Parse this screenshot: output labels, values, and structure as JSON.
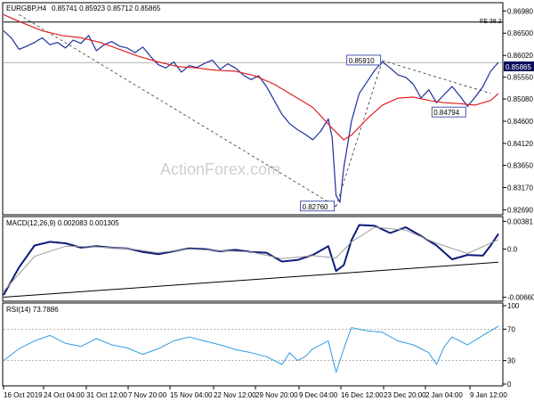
{
  "chart_data": {
    "type": "line",
    "instrument": {
      "symbol": "EURGBP,H4",
      "ohlc": "0.85741 0.85923 0.85712 0.85865"
    },
    "watermark": "ActionForex.com",
    "x_ticks": [
      "16 Oct 2019",
      "24 Oct 04:00",
      "31 Oct 12:00",
      "7 Nov 20:00",
      "15 Nov 04:00",
      "22 Nov 12:00",
      "29 Nov 20:00",
      "9 Dec 04:00",
      "16 Dec 12:00",
      "23 Dec 20:00",
      "2 Jan 04:00",
      "9 Jan 12:00"
    ],
    "price": {
      "y_ticks": [
        "0.86980",
        "0.86500",
        "0.86020",
        "0.85550",
        "0.85080",
        "0.84600",
        "0.84120",
        "0.83650",
        "0.83170",
        "0.82690"
      ],
      "ylim": [
        0.8264,
        0.8712
      ],
      "current_label": "0.85865",
      "fe_label": "FE 38.2",
      "fe_value": 0.8674,
      "annotations": [
        {
          "text": "0.85910",
          "x": 98,
          "y": 0.8591
        },
        {
          "text": "0.84794",
          "x": 120,
          "y": 0.8479
        },
        {
          "text": "0.82760",
          "x": 86,
          "y": 0.8276
        }
      ],
      "series": [
        {
          "name": "price",
          "color": "#1f2f9a",
          "x": [
            0,
            2,
            4,
            6,
            8,
            10,
            12,
            14,
            16,
            18,
            20,
            22,
            24,
            26,
            28,
            30,
            32,
            34,
            36,
            38,
            40,
            42,
            44,
            46,
            48,
            50,
            52,
            54,
            56,
            58,
            60,
            62,
            64,
            66,
            68,
            70,
            72,
            74,
            76,
            78,
            80,
            82,
            84,
            85,
            86,
            87,
            88,
            90,
            92,
            94,
            96,
            98,
            100,
            102,
            104,
            106,
            108,
            110,
            112,
            114,
            116,
            118,
            120,
            122,
            124,
            126,
            128
          ],
          "values": [
            0.8655,
            0.864,
            0.8615,
            0.8622,
            0.863,
            0.864,
            0.8625,
            0.863,
            0.8618,
            0.8635,
            0.8628,
            0.8645,
            0.8612,
            0.8625,
            0.8632,
            0.8622,
            0.8618,
            0.8608,
            0.862,
            0.86,
            0.8582,
            0.8575,
            0.8588,
            0.8566,
            0.858,
            0.8576,
            0.8585,
            0.8592,
            0.8572,
            0.8584,
            0.8575,
            0.856,
            0.855,
            0.8558,
            0.8535,
            0.8505,
            0.8475,
            0.8455,
            0.8442,
            0.8432,
            0.842,
            0.8438,
            0.8465,
            0.8425,
            0.83,
            0.8285,
            0.836,
            0.846,
            0.852,
            0.8545,
            0.857,
            0.8588,
            0.8575,
            0.856,
            0.8555,
            0.854,
            0.851,
            0.8528,
            0.85,
            0.8518,
            0.8535,
            0.8515,
            0.8492,
            0.8512,
            0.8535,
            0.8568,
            0.8587
          ]
        },
        {
          "name": "moving average",
          "color": "#e02020",
          "x": [
            0,
            5,
            10,
            15,
            20,
            25,
            30,
            35,
            40,
            45,
            50,
            55,
            60,
            65,
            70,
            75,
            80,
            85,
            88,
            90,
            94,
            98,
            102,
            106,
            110,
            114,
            118,
            122,
            126,
            128
          ],
          "values": [
            0.869,
            0.8672,
            0.8655,
            0.8645,
            0.864,
            0.863,
            0.8615,
            0.86,
            0.8588,
            0.8578,
            0.8575,
            0.857,
            0.8568,
            0.8558,
            0.854,
            0.8515,
            0.849,
            0.8445,
            0.842,
            0.843,
            0.8465,
            0.8495,
            0.851,
            0.8512,
            0.8505,
            0.85,
            0.8498,
            0.8495,
            0.8505,
            0.852
          ]
        }
      ]
    },
    "macd": {
      "title": "MACD(12,26,9) 0.002083 0.001305",
      "y_ticks": [
        "0.00381",
        "0.0",
        "-0.006607"
      ],
      "ylim": [
        -0.0069,
        0.0041
      ],
      "series": [
        {
          "name": "MACD",
          "color": "#0d1b7a",
          "x": [
            0,
            4,
            8,
            12,
            16,
            20,
            24,
            28,
            32,
            36,
            40,
            44,
            48,
            52,
            56,
            60,
            64,
            68,
            72,
            76,
            80,
            84,
            86,
            88,
            90,
            92,
            96,
            100,
            104,
            108,
            112,
            116,
            120,
            124,
            126,
            128
          ],
          "values": [
            -0.0063,
            -0.0025,
            0.0005,
            0.001,
            0.0008,
            0.0002,
            0.0004,
            0.0002,
            0.0001,
            -0.0004,
            -0.0007,
            -0.0003,
            0.0001,
            0.0,
            -0.0003,
            -0.0001,
            -0.0004,
            -0.0005,
            -0.0017,
            -0.0015,
            -0.0008,
            0.0004,
            -0.003,
            -0.0022,
            0.0012,
            0.0033,
            0.0032,
            0.0022,
            0.003,
            0.0018,
            0.0005,
            -0.0014,
            -0.0008,
            -0.0009,
            0.0005,
            0.0021
          ]
        },
        {
          "name": "signal",
          "color": "#9a9a9a",
          "x": [
            0,
            8,
            16,
            24,
            32,
            40,
            48,
            56,
            64,
            72,
            80,
            86,
            90,
            96,
            104,
            112,
            120,
            128
          ],
          "values": [
            -0.0058,
            -0.001,
            0.0004,
            0.0003,
            0.0001,
            -0.0005,
            0.0,
            -0.0002,
            -0.0004,
            -0.0013,
            -0.0009,
            -0.0012,
            0.001,
            0.003,
            0.0026,
            0.0008,
            -0.0006,
            0.0013
          ]
        },
        {
          "name": "trendline",
          "color": "#000000",
          "x": [
            0,
            128
          ],
          "values": [
            -0.0066,
            -0.0018
          ]
        }
      ]
    },
    "rsi": {
      "title": "RSI(14) 73.7886",
      "y_ticks": [
        "100",
        "70",
        "30",
        "0"
      ],
      "ylim": [
        0,
        100
      ],
      "levels": [
        70,
        30
      ],
      "series": [
        {
          "name": "RSI",
          "color": "#2f9be0",
          "x": [
            0,
            4,
            8,
            12,
            16,
            20,
            24,
            28,
            32,
            36,
            40,
            44,
            48,
            52,
            56,
            60,
            64,
            68,
            72,
            74,
            76,
            78,
            80,
            84,
            86,
            88,
            90,
            94,
            98,
            102,
            106,
            110,
            112,
            114,
            116,
            120,
            124,
            126,
            128
          ],
          "values": [
            30,
            45,
            55,
            62,
            52,
            48,
            58,
            50,
            46,
            38,
            45,
            55,
            60,
            55,
            50,
            44,
            40,
            35,
            25,
            40,
            30,
            35,
            45,
            55,
            15,
            45,
            72,
            68,
            66,
            55,
            50,
            40,
            25,
            48,
            60,
            50,
            62,
            68,
            74
          ]
        }
      ]
    }
  }
}
